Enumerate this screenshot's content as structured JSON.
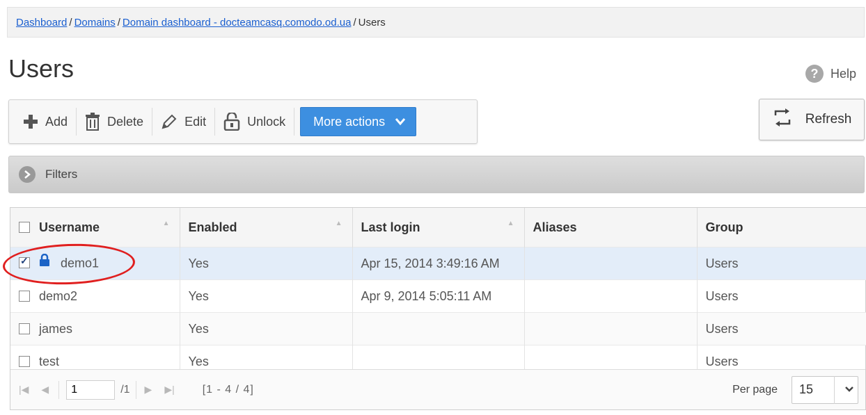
{
  "breadcrumb": {
    "items": [
      "Dashboard",
      "Domains",
      "Domain dashboard - docteamcasq.comodo.od.ua"
    ],
    "current": "Users",
    "separator": "/"
  },
  "page": {
    "title": "Users",
    "help_label": "Help"
  },
  "toolbar": {
    "add": "Add",
    "delete": "Delete",
    "edit": "Edit",
    "unlock": "Unlock",
    "more_actions": "More actions"
  },
  "refresh_label": "Refresh",
  "filters_label": "Filters",
  "table": {
    "columns": [
      "Username",
      "Enabled",
      "Last login",
      "Aliases",
      "Group"
    ],
    "rows": [
      {
        "username": "demo1",
        "enabled": "Yes",
        "last_login": "Apr 15, 2014 3:49:16 AM",
        "aliases": "",
        "group": "Users",
        "checked": true,
        "locked": true
      },
      {
        "username": "demo2",
        "enabled": "Yes",
        "last_login": "Apr 9, 2014 5:05:11 AM",
        "aliases": "",
        "group": "Users",
        "checked": false,
        "locked": false
      },
      {
        "username": "james",
        "enabled": "Yes",
        "last_login": "",
        "aliases": "",
        "group": "Users",
        "checked": false,
        "locked": false
      },
      {
        "username": "test",
        "enabled": "Yes",
        "last_login": "",
        "aliases": "",
        "group": "Users",
        "checked": false,
        "locked": false
      }
    ]
  },
  "pagination": {
    "page_value": "1",
    "page_total": "/1",
    "range": "[1 - 4 / 4]",
    "per_page_label": "Per page",
    "per_page_value": "15"
  },
  "colors": {
    "link": "#1a5fd0",
    "primary_button": "#3d8fe0",
    "selected_row": "#e3edf9",
    "annotation": "#e01f1f"
  }
}
